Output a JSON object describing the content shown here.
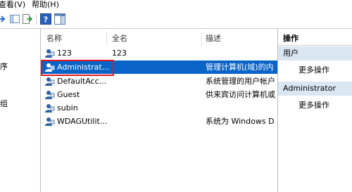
{
  "menu": {
    "view": "查看(V)",
    "help": "帮助(H)"
  },
  "left_pane": {
    "item1": "序",
    "item2": "组"
  },
  "columns": {
    "name": "名称",
    "fullname": "全名",
    "description": "描述"
  },
  "rows": [
    {
      "name": "123",
      "fullname": "123",
      "description": ""
    },
    {
      "name": "Administrat...",
      "fullname": "",
      "description": "管理计算机(域)的内"
    },
    {
      "name": "DefaultAcc...",
      "fullname": "",
      "description": "系统管理的用户帐户"
    },
    {
      "name": "Guest",
      "fullname": "",
      "description": "供来宾访问计算机或"
    },
    {
      "name": "subin",
      "fullname": "",
      "description": ""
    },
    {
      "name": "WDAGUtilit...",
      "fullname": "",
      "description": "系统为 Windows D"
    }
  ],
  "actions": {
    "title": "操作",
    "group1": "用户",
    "group1_more": "更多操作",
    "group2": "Administrator",
    "group2_more": "更多操作"
  },
  "colors": {
    "selection": "#0a64c8",
    "highlight_box": "#e0171f",
    "action_group_bg": "#dbe6f3"
  }
}
